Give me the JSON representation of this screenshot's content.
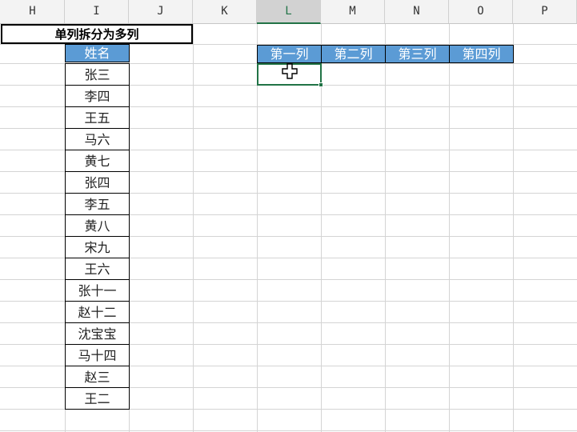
{
  "columns": [
    {
      "letter": "H",
      "selected": false
    },
    {
      "letter": "I",
      "selected": false
    },
    {
      "letter": "J",
      "selected": false
    },
    {
      "letter": "K",
      "selected": false
    },
    {
      "letter": "L",
      "selected": true
    },
    {
      "letter": "M",
      "selected": false
    },
    {
      "letter": "N",
      "selected": false
    },
    {
      "letter": "O",
      "selected": false
    },
    {
      "letter": "P",
      "selected": false
    }
  ],
  "title": "单列拆分为多列",
  "name_header": "姓名",
  "names": [
    "张三",
    "李四",
    "王五",
    "马六",
    "黄七",
    "张四",
    "李五",
    "黄八",
    "宋九",
    "王六",
    "张十一",
    "赵十二",
    "沈宝宝",
    "马十四",
    "赵三",
    "王二"
  ],
  "split_headers": [
    "第一列",
    "第二列",
    "第三列",
    "第四列"
  ],
  "active_cell_value": "",
  "colors": {
    "header_fill": "#5b9bd5",
    "selection": "#217346"
  },
  "cursor_icon": "excel-select-cross-icon"
}
